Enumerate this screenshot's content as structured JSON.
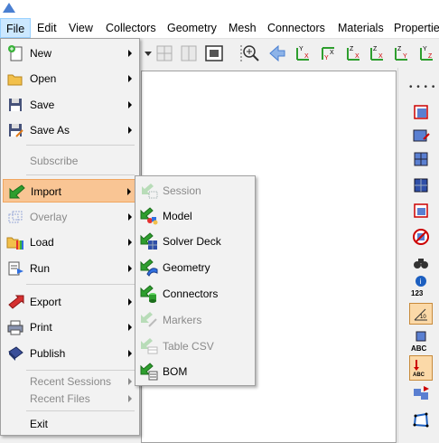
{
  "menubar": {
    "items": [
      "File",
      "Edit",
      "View",
      "Collectors",
      "Geometry",
      "Mesh",
      "Connectors",
      "Materials",
      "Propertie"
    ]
  },
  "file_menu": {
    "items": [
      {
        "label": "New",
        "enabled": true,
        "submenu": true
      },
      {
        "label": "Open",
        "enabled": true,
        "submenu": true
      },
      {
        "label": "Save",
        "enabled": true,
        "submenu": true
      },
      {
        "label": "Save As",
        "enabled": true,
        "submenu": true
      },
      {
        "label": "Subscribe",
        "enabled": false,
        "submenu": false
      },
      {
        "label": "Import",
        "enabled": true,
        "submenu": true,
        "highlighted": true
      },
      {
        "label": "Overlay",
        "enabled": false,
        "submenu": true
      },
      {
        "label": "Load",
        "enabled": true,
        "submenu": true
      },
      {
        "label": "Run",
        "enabled": true,
        "submenu": true
      },
      {
        "label": "Export",
        "enabled": true,
        "submenu": true
      },
      {
        "label": "Print",
        "enabled": true,
        "submenu": true
      },
      {
        "label": "Publish",
        "enabled": true,
        "submenu": true
      },
      {
        "label": "Recent Sessions",
        "enabled": false,
        "submenu": true
      },
      {
        "label": "Recent Files",
        "enabled": false,
        "submenu": true
      },
      {
        "label": "Exit",
        "enabled": true,
        "submenu": false
      }
    ]
  },
  "import_submenu": {
    "items": [
      {
        "label": "Session",
        "enabled": false
      },
      {
        "label": "Model",
        "enabled": true
      },
      {
        "label": "Solver Deck",
        "enabled": true
      },
      {
        "label": "Geometry",
        "enabled": true
      },
      {
        "label": "Connectors",
        "enabled": true
      },
      {
        "label": "Markers",
        "enabled": false
      },
      {
        "label": "Table CSV",
        "enabled": false
      },
      {
        "label": "BOM",
        "enabled": true
      }
    ]
  },
  "toolbar": {
    "axis_buttons": [
      "Y X",
      "Y X",
      "Z X",
      "Z X",
      "Z Y",
      "Y Z"
    ]
  },
  "rightbar": {
    "label_123": "123",
    "label_abc1": "ABC",
    "label_abc2": "ABC",
    "label_abc3": "ABC",
    "label_10": "10"
  },
  "colors": {
    "highlight": "#f9c594",
    "menubar_active": "#cce8ff",
    "arrow_green": "#2e9e2e",
    "disabled_text": "#8a8a8a"
  }
}
